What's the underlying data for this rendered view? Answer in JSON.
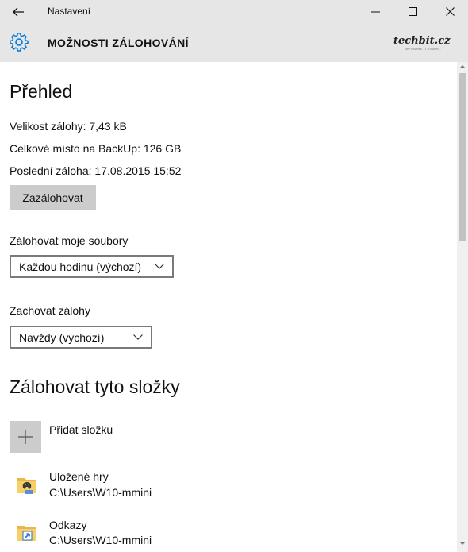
{
  "titlebar": {
    "app_title": "Nastavení",
    "back_icon": "arrow-left-icon",
    "minimize_icon": "minimize-icon",
    "maximize_icon": "maximize-icon",
    "close_icon": "close-icon"
  },
  "header": {
    "icon": "gear-icon",
    "title": "MOŽNOSTI ZÁLOHOVÁNÍ",
    "brand": "techbit.cz",
    "brand_tagline": "Bez novinek, IT a vůbec..."
  },
  "overview": {
    "heading": "Přehled",
    "backup_size": "Velikost zálohy: 7,43 kB",
    "total_space": "Celkové místo na BackUp: 126 GB",
    "last_backup": "Poslední záloha: 17.08.2015 15:52",
    "backup_button": "Zazálohovat"
  },
  "backup_frequency": {
    "label": "Zálohovat moje soubory",
    "selected": "Každou hodinu (výchozí)"
  },
  "keep_backups": {
    "label": "Zachovat zálohy",
    "selected": "Navždy (výchozí)"
  },
  "folders": {
    "heading": "Zálohovat tyto složky",
    "add_label": "Přidat složku",
    "items": [
      {
        "name": "Uložené hry",
        "path": "C:\\Users\\W10-mmini",
        "icon": "saved-games-folder-icon"
      },
      {
        "name": "Odkazy",
        "path": "C:\\Users\\W10-mmini",
        "icon": "links-folder-icon"
      }
    ]
  },
  "colors": {
    "chrome": "#e6e6e6",
    "accent": "#0078d7",
    "button": "#cccccc"
  }
}
